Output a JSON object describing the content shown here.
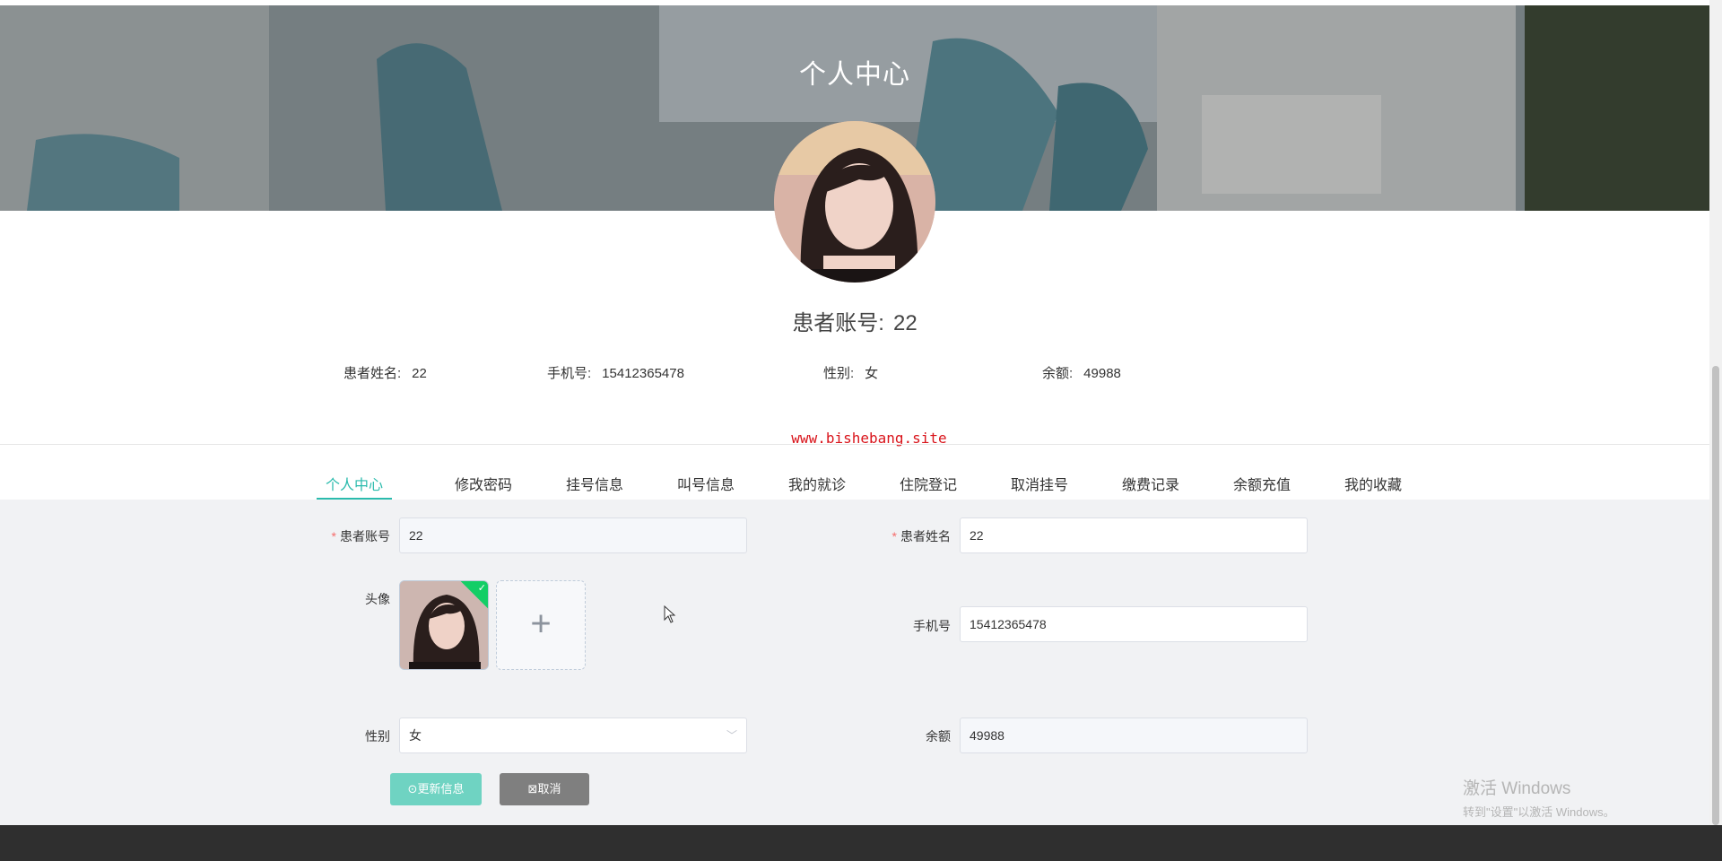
{
  "hero": {
    "title": "个人中心"
  },
  "account": {
    "label": "患者账号:",
    "value": "22"
  },
  "info": {
    "name_label": "患者姓名:",
    "name_value": "22",
    "phone_label": "手机号:",
    "phone_value": "15412365478",
    "gender_label": "性别:",
    "gender_value": "女",
    "balance_label": "余额:",
    "balance_value": "49988"
  },
  "watermark": "www.bishebang.site",
  "tabs": [
    {
      "label": "个人中心",
      "active": true
    },
    {
      "label": "修改密码"
    },
    {
      "label": "挂号信息"
    },
    {
      "label": "叫号信息"
    },
    {
      "label": "我的就诊"
    },
    {
      "label": "住院登记"
    },
    {
      "label": "取消挂号"
    },
    {
      "label": "缴费记录"
    },
    {
      "label": "余额充值"
    },
    {
      "label": "我的收藏"
    }
  ],
  "form": {
    "account_label": "患者账号",
    "account_value": "22",
    "name_label": "患者姓名",
    "name_value": "22",
    "avatar_label": "头像",
    "phone_label": "手机号",
    "phone_value": "15412365478",
    "gender_label": "性别",
    "gender_value": "女",
    "balance_label": "余额",
    "balance_value": "49988",
    "required_mark": "*",
    "upload_plus": "+"
  },
  "buttons": {
    "update": "更新信息",
    "cancel": "取消"
  },
  "windows_activation": {
    "line1": "激活 Windows",
    "line2": "转到\"设置\"以激活 Windows。"
  },
  "colors": {
    "accent": "#2bbbad",
    "update_button": "#6fd3c2",
    "cancel_button": "#7f7f7f",
    "watermark": "#d9141b",
    "footer": "#2f2f2f"
  },
  "icons": {
    "update": "check-circle-icon",
    "cancel": "close-square-icon",
    "upload_ok": "check-icon",
    "select": "chevron-down-icon"
  }
}
